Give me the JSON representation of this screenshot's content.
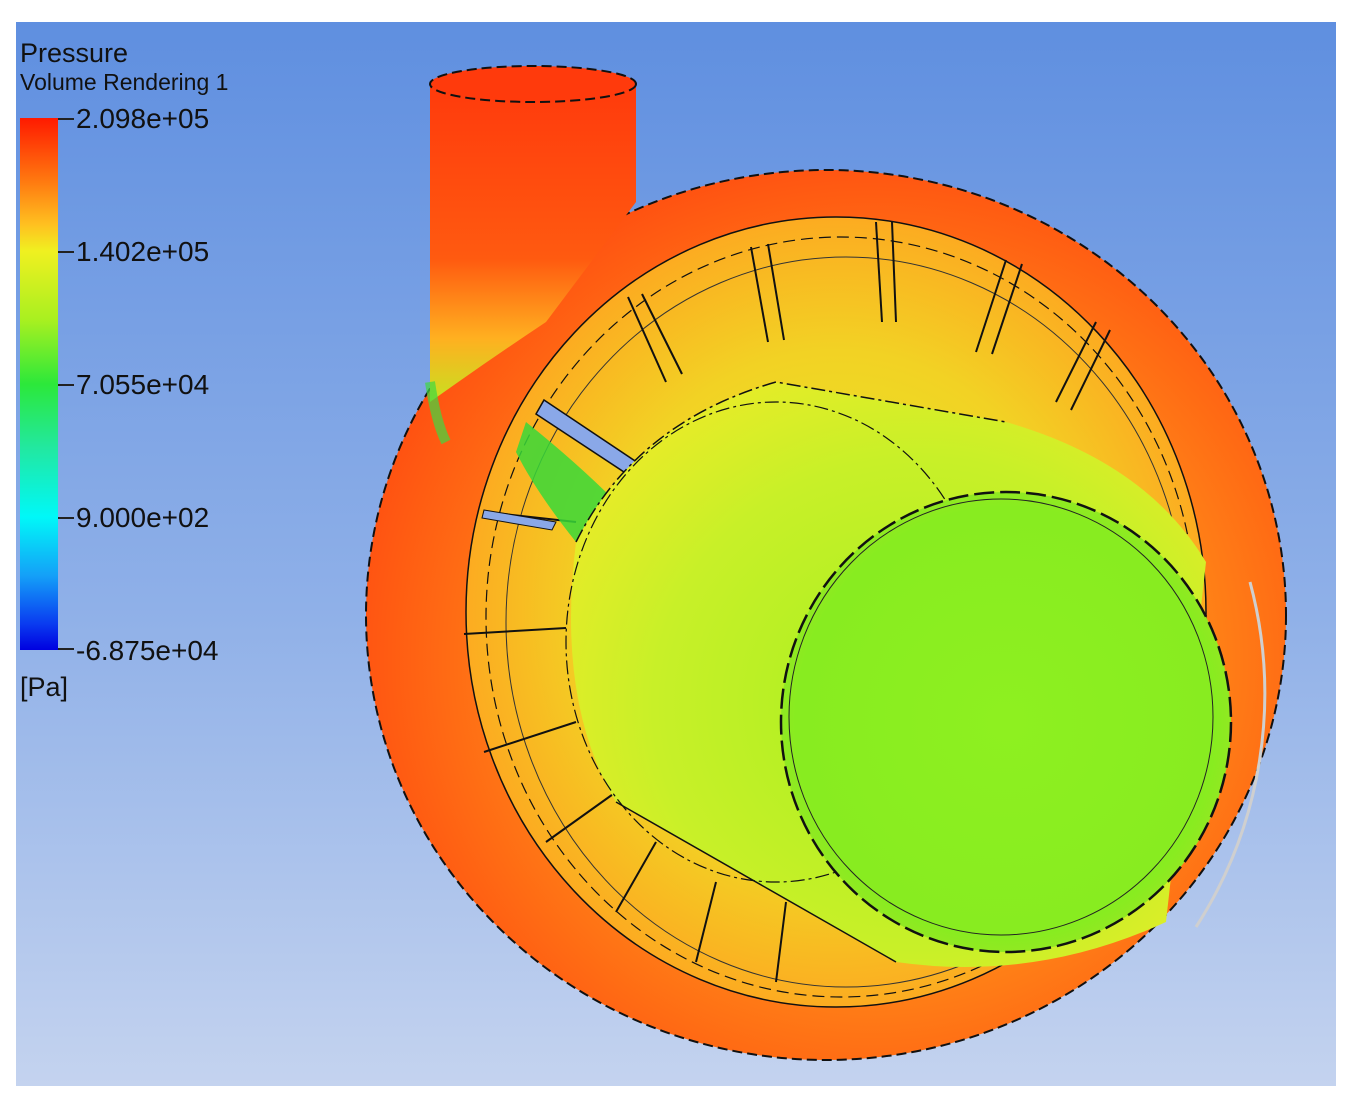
{
  "legend": {
    "title": "Pressure",
    "subtitle": "Volume Rendering 1",
    "ticks": [
      "2.098e+05",
      "1.402e+05",
      "7.055e+04",
      "9.000e+02",
      "-6.875e+04"
    ],
    "unit": "[Pa]",
    "range": [
      -68750,
      209800
    ],
    "colormap": [
      "#0000e0",
      "#0a3cf0",
      "#14a0f8",
      "#00f8f8",
      "#22e8a0",
      "#2ce83a",
      "#a8f020",
      "#f0f020",
      "#ffc020",
      "#ff7a10",
      "#ff1a00"
    ]
  },
  "background": {
    "top": "#5f8fe0",
    "bottom": "#c4d3ef"
  },
  "model": {
    "description_colors": {
      "casing_high": "#ff4a10",
      "casing_mid": "#ff8a18",
      "impeller_ring": "#f2c624",
      "hub": "#c8f028",
      "eye": "#8ef020",
      "low_zone": "#38d838",
      "outline": "#111111"
    }
  }
}
